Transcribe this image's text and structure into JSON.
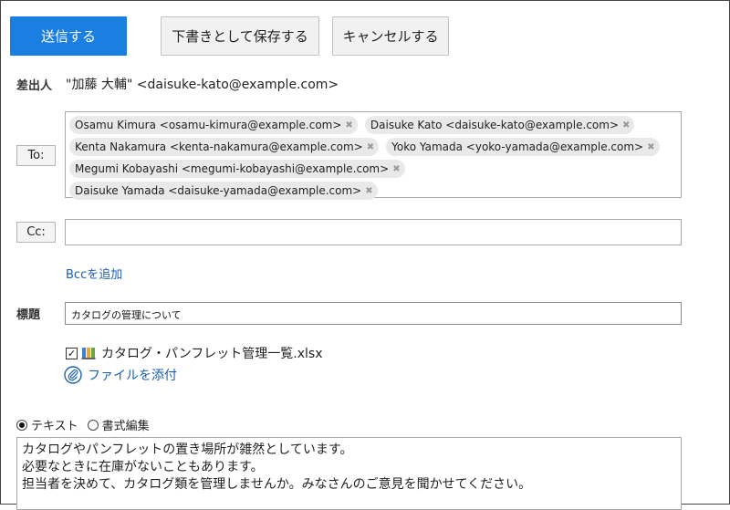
{
  "toolbar": {
    "send_label": "送信する",
    "save_draft_label": "下書きとして保存する",
    "cancel_label": "キャンセルする"
  },
  "sender": {
    "label": "差出人",
    "value": "\"加藤 大輔\" <daisuke-kato@example.com>"
  },
  "to": {
    "button_label": "To:",
    "recipients": [
      "Osamu Kimura <osamu-kimura@example.com>",
      "Daisuke Kato <daisuke-kato@example.com>",
      "Kenta Nakamura <kenta-nakamura@example.com>",
      "Yoko Yamada <yoko-yamada@example.com>",
      "Megumi Kobayashi <megumi-kobayashi@example.com>",
      "Daisuke Yamada <daisuke-yamada@example.com>"
    ],
    "remove_glyph": "✖"
  },
  "cc": {
    "button_label": "Cc:",
    "value": ""
  },
  "bcc": {
    "link_label": "Bccを追加"
  },
  "subject": {
    "label": "標題",
    "value": "カタログの管理について"
  },
  "attachments": {
    "files": [
      {
        "name": "カタログ・パンフレット管理一覧.xlsx",
        "checked": true,
        "icon": "spreadsheet-file-icon"
      }
    ],
    "add_link_label": "ファイルを添付",
    "add_icon": "paperclip-icon"
  },
  "format": {
    "options": [
      "テキスト",
      "書式編集"
    ],
    "selected": "テキスト"
  },
  "body": {
    "lines": [
      "カタログやパンフレットの置き場所が雑然としています。",
      "必要なときに在庫がないこともあります。",
      "担当者を決めて、カタログ類を管理しませんか。みなさんのご意見を聞かせてください。"
    ]
  },
  "colors": {
    "primary": "#1a7fe0",
    "link": "#1a5fb4",
    "chip_bg": "#e9e9e9"
  }
}
